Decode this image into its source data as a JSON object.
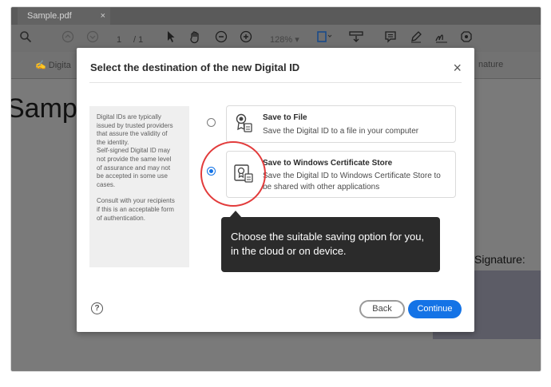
{
  "app": {
    "tab_title": "Sample.pdf",
    "tab_close": "×"
  },
  "toolbar": {
    "page_current": "1",
    "page_total": "/ 1",
    "zoom": "128%"
  },
  "toolbar2": {
    "left_label": "Digita",
    "right_label": "nature"
  },
  "document": {
    "title_fragment": "Sampl",
    "signature_label": "Signature:"
  },
  "dialog": {
    "title": "Select the destination of the new Digital ID",
    "close": "×",
    "info": {
      "paragraph1": "Digital IDs are typically\nissued by trusted providers\nthat assure the validity of\nthe identity.\nSelf-signed Digital ID may\nnot provide the same level\nof assurance and may not\nbe accepted in some use\ncases.",
      "paragraph2": "Consult with your recipients\nif this is an acceptable form\nof authentication."
    },
    "options": [
      {
        "title": "Save to File",
        "description": "Save the Digital ID to a file in your computer",
        "selected": false
      },
      {
        "title": "Save to Windows Certificate Store",
        "description": "Save the Digital ID to Windows Certificate Store to be shared with other applications",
        "selected": true
      }
    ],
    "help": "?",
    "back_label": "Back",
    "continue_label": "Continue"
  },
  "tooltip": {
    "text": "Choose the suitable saving option for you, in the cloud or on device."
  },
  "colors": {
    "accent": "#1473e6",
    "highlight_ring": "#e23b3b",
    "tooltip_bg": "#2b2b2b"
  },
  "icons": [
    "search-icon",
    "page-up-icon",
    "page-down-icon",
    "select-arrow-icon",
    "hand-icon",
    "zoom-out-icon",
    "zoom-in-icon",
    "fit-page-icon",
    "scroll-mode-icon",
    "comment-icon",
    "pen-icon",
    "sign-icon",
    "more-tools-icon",
    "certificate-file-icon",
    "certificate-store-icon",
    "help-icon"
  ]
}
